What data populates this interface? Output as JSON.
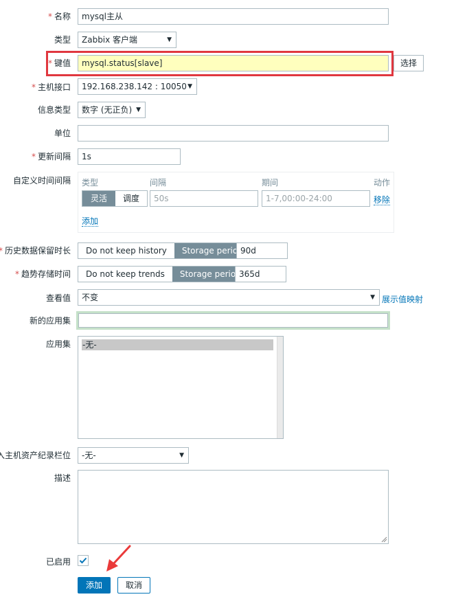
{
  "form": {
    "name": {
      "label": "名称",
      "required": true,
      "value": "mysql主从"
    },
    "type": {
      "label": "类型",
      "required": false,
      "value": "Zabbix 客户端"
    },
    "key": {
      "label": "键值",
      "required": true,
      "value": "mysql.status[slave]",
      "select_button": "选择"
    },
    "host_interface": {
      "label": "主机接口",
      "required": true,
      "value": "192.168.238.142 : 10050"
    },
    "info_type": {
      "label": "信息类型",
      "required": false,
      "value": "数字 (无正负)"
    },
    "units": {
      "label": "单位",
      "required": false,
      "value": ""
    },
    "update_interval": {
      "label": "更新间隔",
      "required": true,
      "value": "1s"
    },
    "custom_intervals": {
      "label": "自定义时间间隔",
      "headers": {
        "type": "类型",
        "interval": "间隔",
        "period": "期间",
        "action": "动作"
      },
      "rows": [
        {
          "mode_options": [
            "灵活",
            "调度"
          ],
          "selected_mode": "灵活",
          "interval_placeholder": "50s",
          "period_placeholder": "1-7,00:00-24:00",
          "remove_label": "移除"
        }
      ],
      "add_label": "添加"
    },
    "history": {
      "label": "历史数据保留时长",
      "required": true,
      "options": [
        "Do not keep history",
        "Storage period"
      ],
      "selected": "Storage period",
      "value": "90d"
    },
    "trends": {
      "label": "趋势存储时间",
      "required": true,
      "options": [
        "Do not keep trends",
        "Storage period"
      ],
      "selected": "Storage period",
      "value": "365d"
    },
    "show_value": {
      "label": "查看值",
      "value": "不变",
      "mapping_link": "展示值映射"
    },
    "new_application": {
      "label": "新的应用集",
      "value": ""
    },
    "applications": {
      "label": "应用集",
      "items": [
        "-无-"
      ],
      "selected": "-无-"
    },
    "inventory_field": {
      "label": "入主机资产纪录栏位",
      "value": "-无-"
    },
    "description": {
      "label": "描述",
      "value": ""
    },
    "enabled": {
      "label": "已启用",
      "checked": true
    },
    "buttons": {
      "add": "添加",
      "cancel": "取消"
    }
  },
  "colors": {
    "highlight_box": "#e0373f",
    "key_field_bg": "#ffffbe",
    "primary_button": "#0275b8",
    "toggle_active": "#768d99",
    "annotation_arrow": "#ea3a3a"
  }
}
